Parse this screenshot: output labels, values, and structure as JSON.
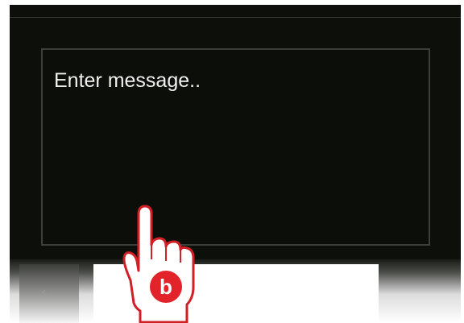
{
  "message": {
    "placeholder": "Enter message.."
  },
  "overlay": {
    "hand_icon": "pointing-hand-icon",
    "badge_letter": "b",
    "badge_color": "#e2232a"
  },
  "colors": {
    "background": "#0d0f0b",
    "border": "#3c3f3a",
    "text": "#f0f0f0"
  }
}
